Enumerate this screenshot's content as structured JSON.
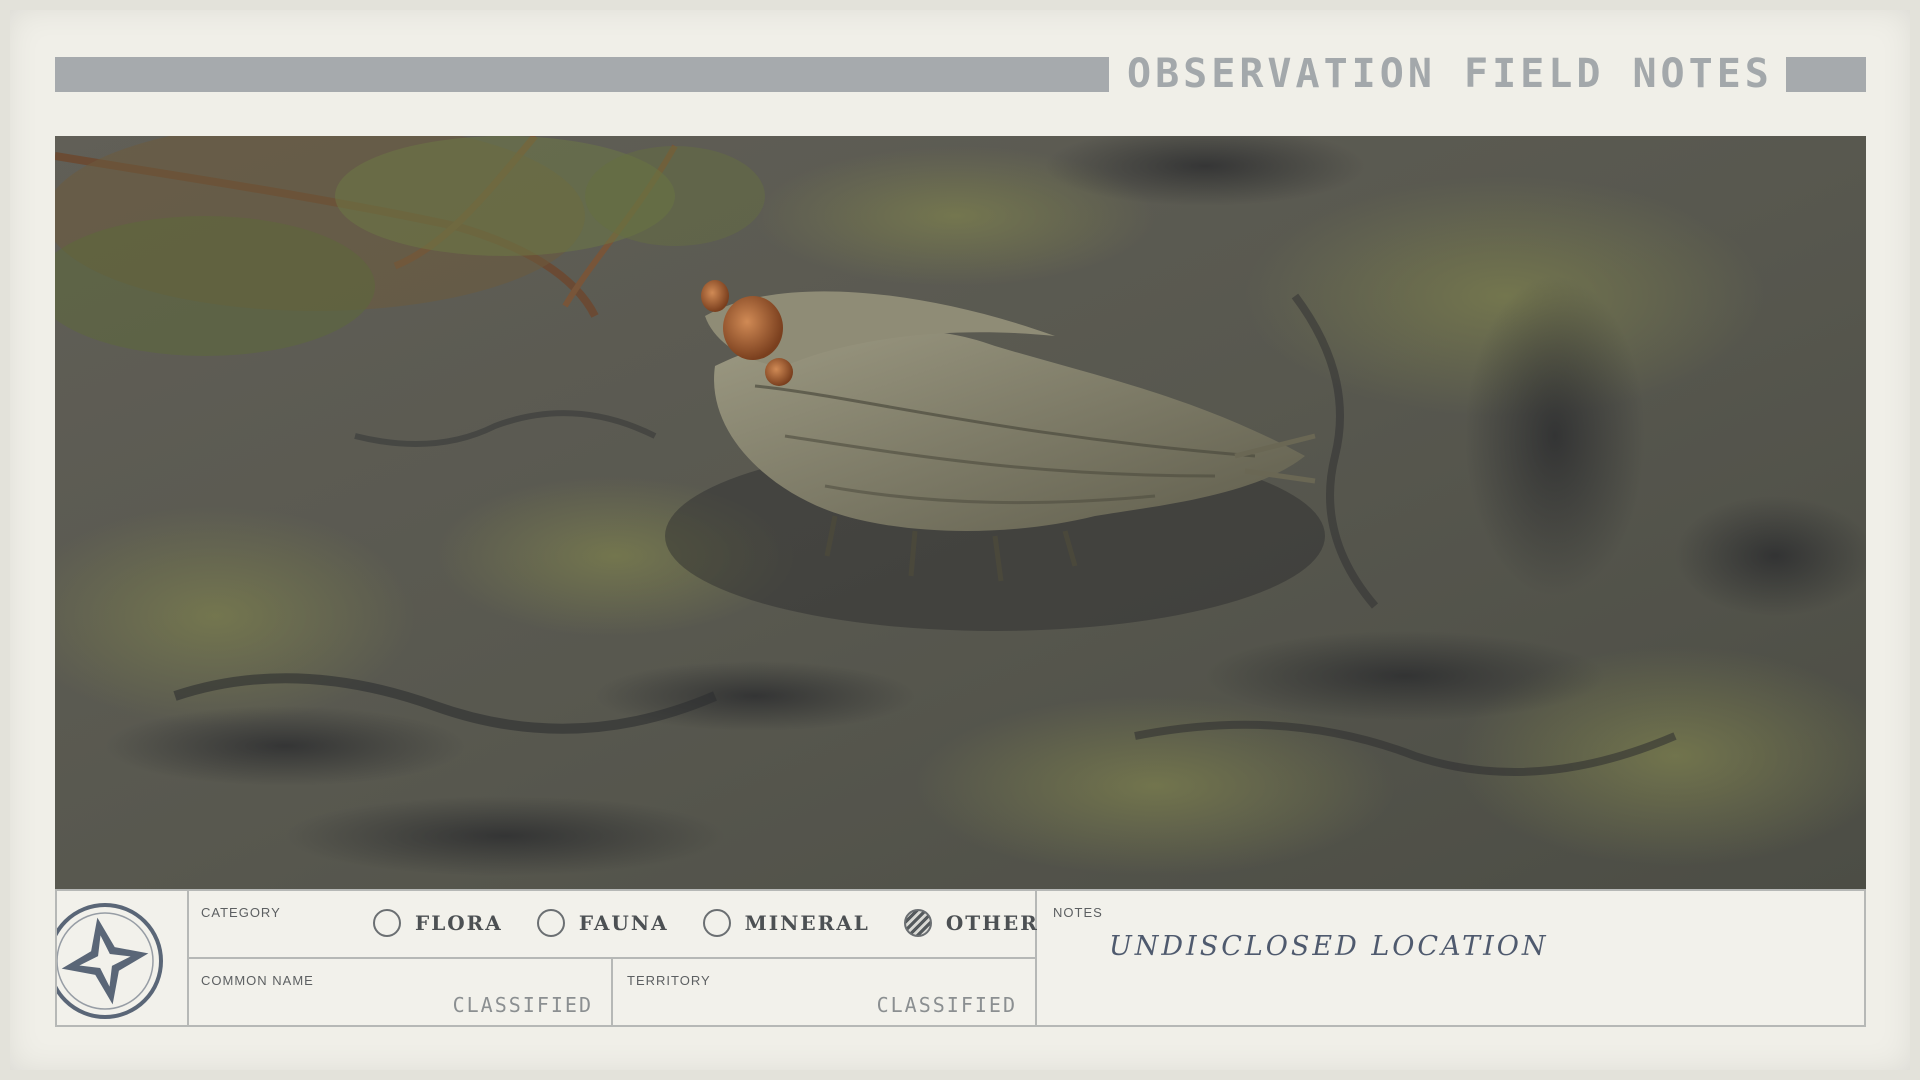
{
  "header": {
    "title": "OBSERVATION FIELD NOTES"
  },
  "category": {
    "label": "CATEGORY",
    "options": [
      {
        "label": "FLORA",
        "selected": false
      },
      {
        "label": "FAUNA",
        "selected": false
      },
      {
        "label": "MINERAL",
        "selected": false
      },
      {
        "label": "OTHER",
        "selected": true
      }
    ]
  },
  "common_name": {
    "label": "COMMON NAME",
    "value": "CLASSIFIED"
  },
  "territory": {
    "label": "TERRITORY",
    "value": "CLASSIFIED"
  },
  "notes": {
    "label": "NOTES",
    "value": "UNDISCLOSED LOCATION"
  },
  "colors": {
    "paper": "#f0efe8",
    "header_bar": "#a6aaad",
    "border": "#b6b8b6",
    "ink": "#4f5a6e"
  },
  "icons": {
    "logo": "four-point-star-seal-icon"
  }
}
